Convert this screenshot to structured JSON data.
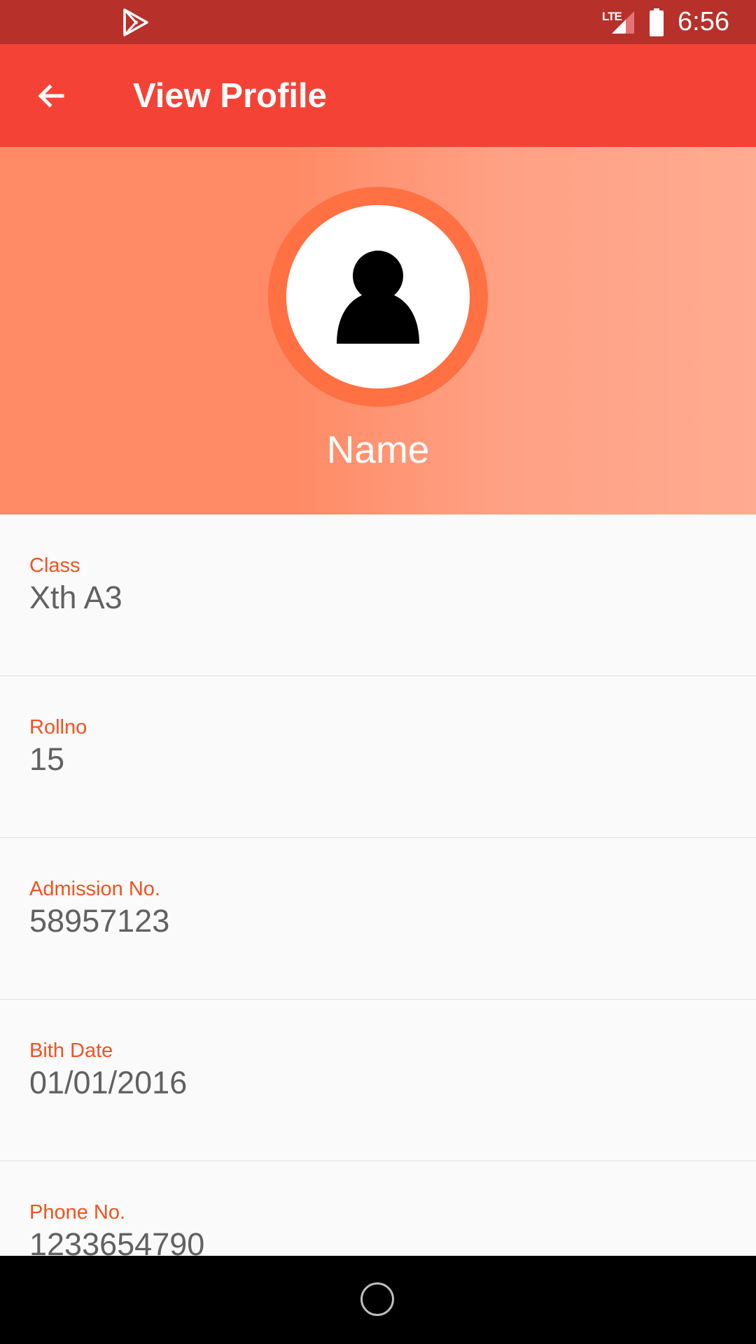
{
  "status_bar": {
    "time": "6:56",
    "network": "LTE",
    "icons": [
      "play-store-icon",
      "lte-signal-icon",
      "battery-icon"
    ]
  },
  "app_bar": {
    "title": "View Profile",
    "back_icon": "arrow-back-icon"
  },
  "profile": {
    "name": "Name",
    "avatar_icon": "person-icon"
  },
  "fields": [
    {
      "label": "Class",
      "value": "Xth A3"
    },
    {
      "label": "Rollno",
      "value": "15"
    },
    {
      "label": "Admission No.",
      "value": "58957123"
    },
    {
      "label": "Bith Date",
      "value": "01/01/2016"
    },
    {
      "label": "Phone No.",
      "value": "1233654790"
    }
  ],
  "colors": {
    "status_bar": "#b8302a",
    "app_bar": "#f44336",
    "header_start": "#ff8a65",
    "header_end": "#ffab91",
    "avatar_ring": "#ff7043",
    "label": "#f4511e",
    "value": "#616161"
  }
}
